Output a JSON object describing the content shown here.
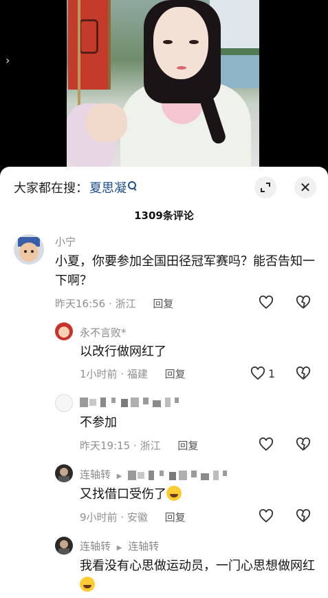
{
  "video": {
    "nav_glyph": "›"
  },
  "header": {
    "search_prefix": "大家都在搜：",
    "search_term": "夏思凝",
    "expand_icon": "expand-icon",
    "close_glyph": "✕"
  },
  "comments_count": "1309条评论",
  "comments": [
    {
      "name": "小宁",
      "text": "小夏，你要参加全国田径冠军赛吗？能否告知一下啊？",
      "time": "昨天16:56",
      "location": "浙江",
      "reply": "回复",
      "likes": ""
    },
    {
      "name": "永不言败*",
      "text": "以改行做网红了",
      "time": "1小时前",
      "location": "福建",
      "reply": "回复",
      "likes": "1"
    },
    {
      "name": "",
      "text": "不参加",
      "time": "昨天19:15",
      "location": "浙江",
      "reply": "回复",
      "likes": ""
    },
    {
      "name": "连轴转",
      "reply_to": "",
      "text": "又找借口受伤了",
      "time": "9小时前",
      "location": "安徽",
      "reply": "回复",
      "likes": ""
    },
    {
      "name": "连轴转",
      "reply_to": "连轴转",
      "text": "我看没有心思做运动员，一门心思想做网红",
      "time": "",
      "location": "",
      "reply": "",
      "likes": ""
    }
  ],
  "icons": {
    "like": "heart-outline-icon",
    "dislike": "broken-heart-icon"
  }
}
